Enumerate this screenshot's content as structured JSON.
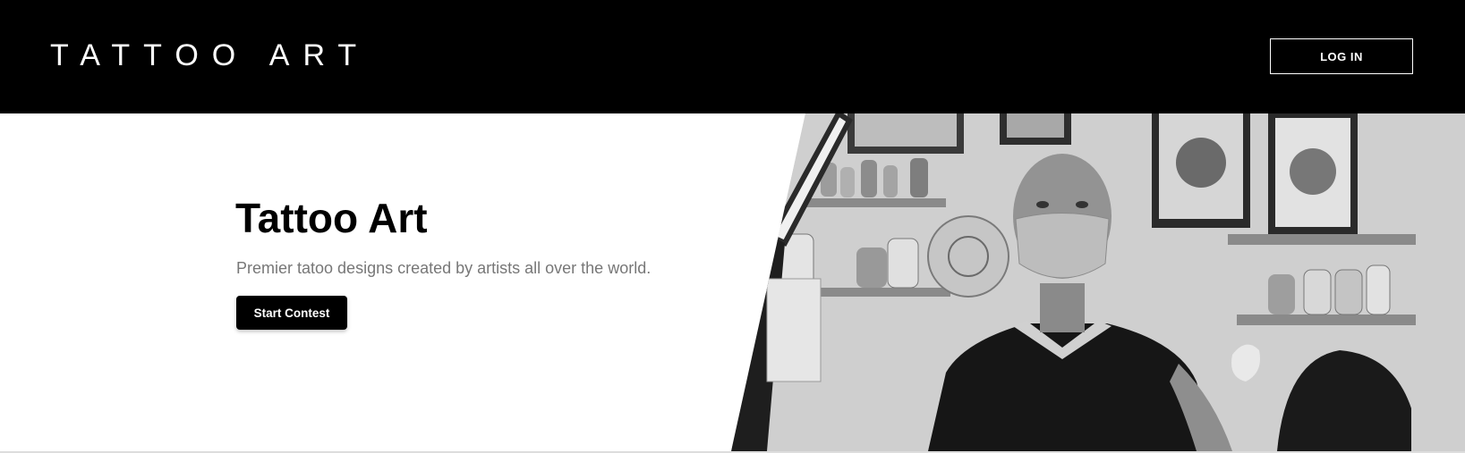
{
  "header": {
    "brand": "TATTOO ART",
    "login_label": "LOG IN"
  },
  "hero": {
    "title": "Tattoo Art",
    "subtitle": "Premier tatoo designs created by artists all over the world.",
    "cta_label": "Start Contest"
  },
  "colors": {
    "header_bg": "#000000",
    "text_primary": "#000000",
    "text_muted": "#777777",
    "button_bg": "#000000",
    "button_text": "#ffffff"
  },
  "photo": {
    "subject": "tattoo-artist-in-studio-photo",
    "style": "black-and-white"
  }
}
